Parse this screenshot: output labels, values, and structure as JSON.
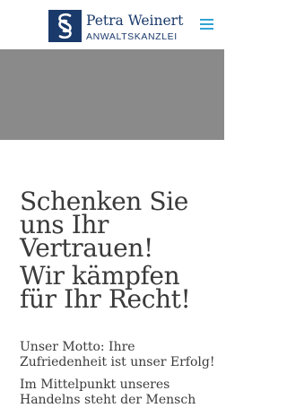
{
  "header": {
    "logo_name": "Petra Weinert",
    "logo_sub": "ANWALTSKANZLEI",
    "logo_icon": "section-sign-icon",
    "menu_icon": "hamburger-menu-icon"
  },
  "colors": {
    "brand": "#1a3a6b",
    "accent": "#2fa4d6",
    "hero_background": "#8a8a8a",
    "text": "#3a3a3a"
  },
  "main": {
    "headline": "Schenken Sie uns Ihr Vertrauen!",
    "subheadline": "Wir kämpfen für Ihr Recht!",
    "motto": "Unser Motto: Ihre Zufriedenheit ist unser Erfolg!",
    "body": "Im Mittelpunkt unseres Handelns steht der Mensch"
  }
}
